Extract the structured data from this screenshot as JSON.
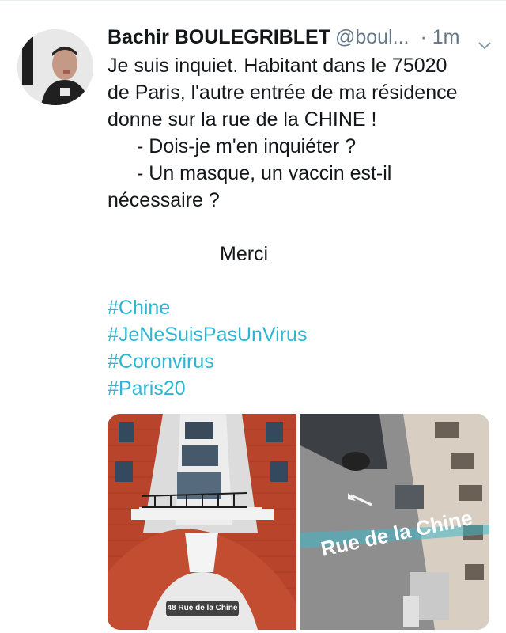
{
  "tweet": {
    "author_name": "Bachir BOULEGRIBLET",
    "author_handle": "@boul...",
    "time": "· 1m",
    "lines": [
      "Je suis inquiet. Habitant dans le 75020",
      "de Paris, l'autre entrée de ma résidence",
      "donne sur la rue de la CHINE !",
      "- Dois-je m'en inquiéter ?",
      "- Un masque, un vaccin est-il",
      "nécessaire ?",
      "Merci"
    ],
    "hashtags": [
      "#Chine",
      "#JeNeSuisPasUnVirus",
      "#Coronvirus",
      "#Paris20"
    ]
  },
  "media": {
    "left_caption": "48 Rue de la Chine",
    "right_street_sign": "Rue de la Chine"
  },
  "colors": {
    "hashtag": "#2fb5d2",
    "secondary_text": "#657786",
    "brick": "#b8442b"
  },
  "icons": {
    "menu_caret": "chevron-down-icon"
  }
}
